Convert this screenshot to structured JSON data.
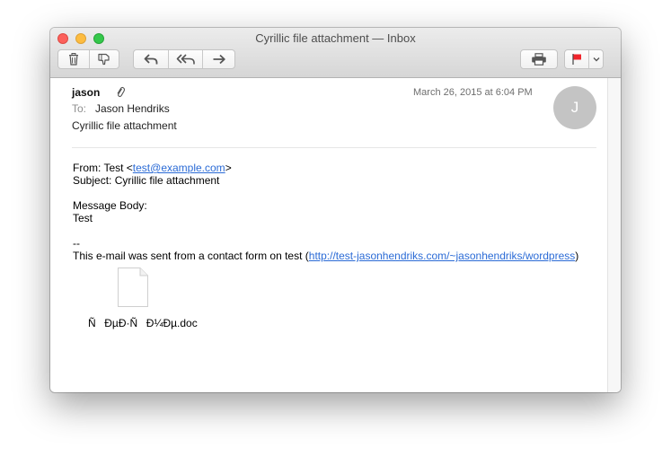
{
  "window": {
    "title": "Cyrillic file attachment — Inbox"
  },
  "toolbar": {
    "icons": [
      "trash-icon",
      "junk-icon",
      "reply-icon",
      "reply-all-icon",
      "forward-icon",
      "print-icon",
      "flag-icon",
      "chevron-down-icon"
    ],
    "flag_color": "#f0242b"
  },
  "message": {
    "sender": "jason",
    "date": "March 26, 2015 at 6:04 PM",
    "avatar_initial": "J",
    "to_label": "To:",
    "to_name": "Jason Hendriks",
    "subject": "Cyrillic file attachment",
    "body": {
      "from_prefix": "From: Test <",
      "from_email": "test@example.com",
      "from_suffix": ">",
      "subject_line": "Subject: Cyrillic file attachment",
      "message_body_label": "Message Body:",
      "message_text": "Test",
      "separator": "--",
      "footer_prefix": "This e-mail was sent from a contact form on test (",
      "footer_link": "http://test-jasonhendriks.com/~jasonhendriks/wordpress",
      "footer_suffix": ")"
    },
    "attachment": {
      "filename": "ÑÐµÐ·ÑÐ¼Ðµ.doc"
    }
  },
  "colors": {
    "link": "#2b6bd6",
    "avatar_bg": "#c4c4c4"
  }
}
